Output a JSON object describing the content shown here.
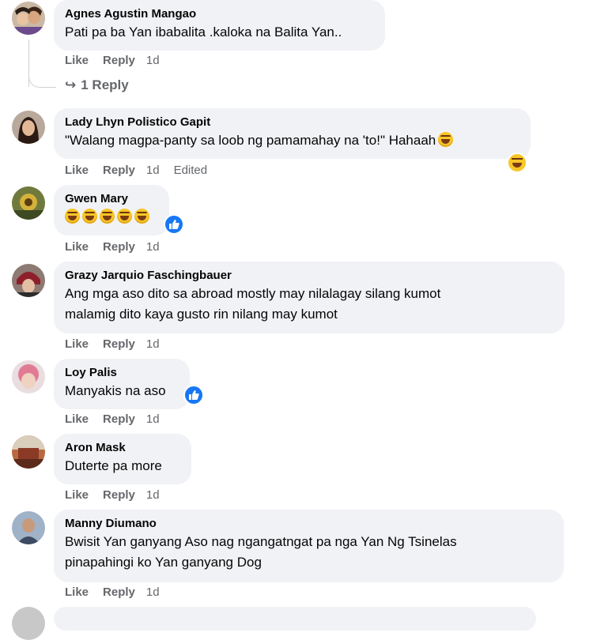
{
  "actions": {
    "like": "Like",
    "reply": "Reply",
    "edited": "Edited"
  },
  "comments": [
    {
      "author": "Agnes Agustin Mangao",
      "lines": [
        "Pati pa ba Yan ibabalita .kaloka na Balita Yan.."
      ],
      "time": "1d",
      "replies_label": "1 Reply"
    },
    {
      "author": "Lady Lhyn Polistico Gapit",
      "lines": [
        "\"Walang magpa-panty sa loob ng pamamahay na 'to!\" Hahaah"
      ],
      "time": "1d",
      "reaction": "haha-icon"
    },
    {
      "author": "Gwen Mary",
      "lines": [
        ""
      ],
      "emoji_count": 5,
      "time": "1d",
      "reaction": "like-icon"
    },
    {
      "author": "Grazy Jarquio Faschingbauer",
      "lines": [
        "Ang mga aso dito sa abroad mostly may nilalagay silang kumot",
        "malamig dito kaya gusto rin nilang may kumot"
      ],
      "time": "1d"
    },
    {
      "author": "Loy Palis",
      "lines": [
        "Manyakis na aso"
      ],
      "time": "1d",
      "reaction": "like-icon"
    },
    {
      "author": "Aron Mask",
      "lines": [
        "Duterte pa more"
      ],
      "time": "1d"
    },
    {
      "author": "Manny Diumano",
      "lines": [
        "Bwisit Yan ganyang Aso nag ngangatngat pa nga Yan Ng Tsinelas",
        "pinapahingi ko Yan ganyang Dog"
      ],
      "time": "1d"
    }
  ],
  "colors": {
    "bubble": "#f0f2f5",
    "meta": "#65676b",
    "like_blue": "#1877f2"
  }
}
